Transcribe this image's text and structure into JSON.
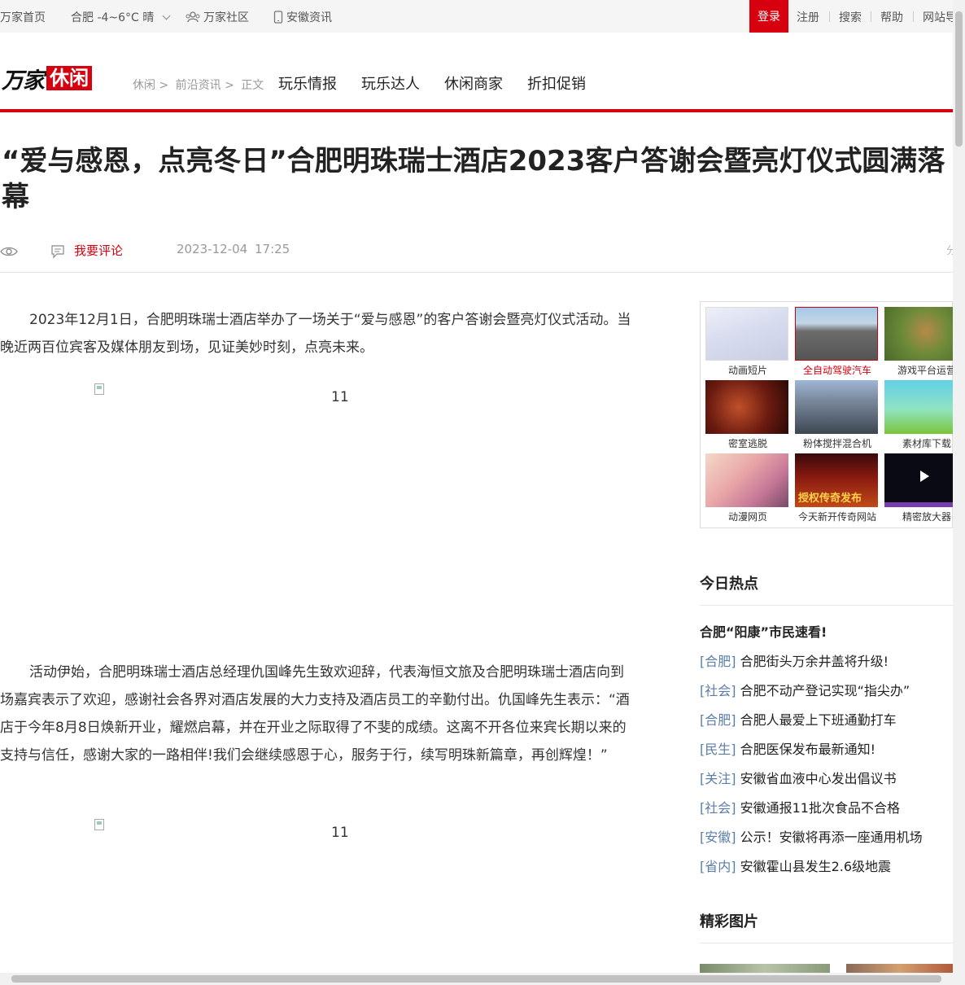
{
  "topbar": {
    "home": "万家首页",
    "weather": "合肥 -4~6°C 晴",
    "community": "万家社区",
    "news": "安徽资讯",
    "login": "登录",
    "register": "注册",
    "search": "搜索",
    "help": "帮助",
    "sitemap": "网站导"
  },
  "header": {
    "logo_main": "万家",
    "logo_tag": "休闲",
    "breadcrumb": [
      "休闲",
      ">",
      "前沿资讯",
      ">",
      "正文"
    ],
    "nav": [
      "玩乐情报",
      "玩乐达人",
      "休闲商家",
      "折扣促销"
    ]
  },
  "article": {
    "title": "“爱与感恩，点亮冬日”合肥明珠瑞士酒店2023客户答谢会暨亮灯仪式圆满落幕",
    "comment_label": "我要评论",
    "date": "2023-12-04",
    "time": "17:25",
    "share": "分",
    "para1": "2023年12月1日，合肥明珠瑞士酒店举办了一场关于“爱与感恩”的客户答谢会暨亮灯仪式活动。当晚近两百位宾客及媒体朋友到场，见证美妙时刻，点亮未来。",
    "img_alt1": "11",
    "para2": "活动伊始，合肥明珠瑞士酒店总经理仇国峰先生致欢迎辞，代表海恒文旅及合肥明珠瑞士酒店向到场嘉宾表示了欢迎，感谢社会各界对酒店发展的大力支持及酒店员工的辛勤付出。仇国峰先生表示：“酒店于今年8月8日焕新开业，耀燃启幕，并在开业之际取得了不斐的成绩。这离不开各位来宾长期以来的支持与信任，感谢大家的一路相伴!我们会继续感恩于心，服务于行，续写明珠新篇章，再创辉煌！”",
    "img_alt2": "11"
  },
  "ads": [
    {
      "caption": "动画短片"
    },
    {
      "caption": "全自动驾驶汽车"
    },
    {
      "caption": "游戏平台运营"
    },
    {
      "caption": "密室逃脱"
    },
    {
      "caption": "粉体搅拌混合机"
    },
    {
      "caption": "素材库下载"
    },
    {
      "caption": "动漫网页"
    },
    {
      "caption": "今天新开传奇网站"
    },
    {
      "caption": "精密放大器"
    }
  ],
  "ad_banner_text": "授权传奇发布",
  "hot": {
    "heading": "今日热点",
    "lead": "合肥“阳康”市民速看!",
    "items": [
      {
        "tag": "[合肥]",
        "text": "合肥街头万余井盖将升级!"
      },
      {
        "tag": "[社会]",
        "text": "合肥不动产登记实现“指尖办”"
      },
      {
        "tag": "[合肥]",
        "text": "合肥人最爱上下班通勤打车"
      },
      {
        "tag": "[民生]",
        "text": "合肥医保发布最新通知!"
      },
      {
        "tag": "[关注]",
        "text": "安徽省血液中心发出倡议书"
      },
      {
        "tag": "[社会]",
        "text": "安徽通报11批次食品不合格"
      },
      {
        "tag": "[安徽]",
        "text": "公示！安徽将再添一座通用机场"
      },
      {
        "tag": "[省内]",
        "text": "安徽霍山县发生2.6级地震"
      }
    ]
  },
  "gallery": {
    "heading": "精彩图片"
  },
  "colors": {
    "accent": "#d7000f",
    "tag": "#5b7ea8"
  },
  "icons": [
    "location-icon",
    "community-icon",
    "phone-icon",
    "eye-icon",
    "comment-icon",
    "chevron-down-icon",
    "play-icon"
  ]
}
